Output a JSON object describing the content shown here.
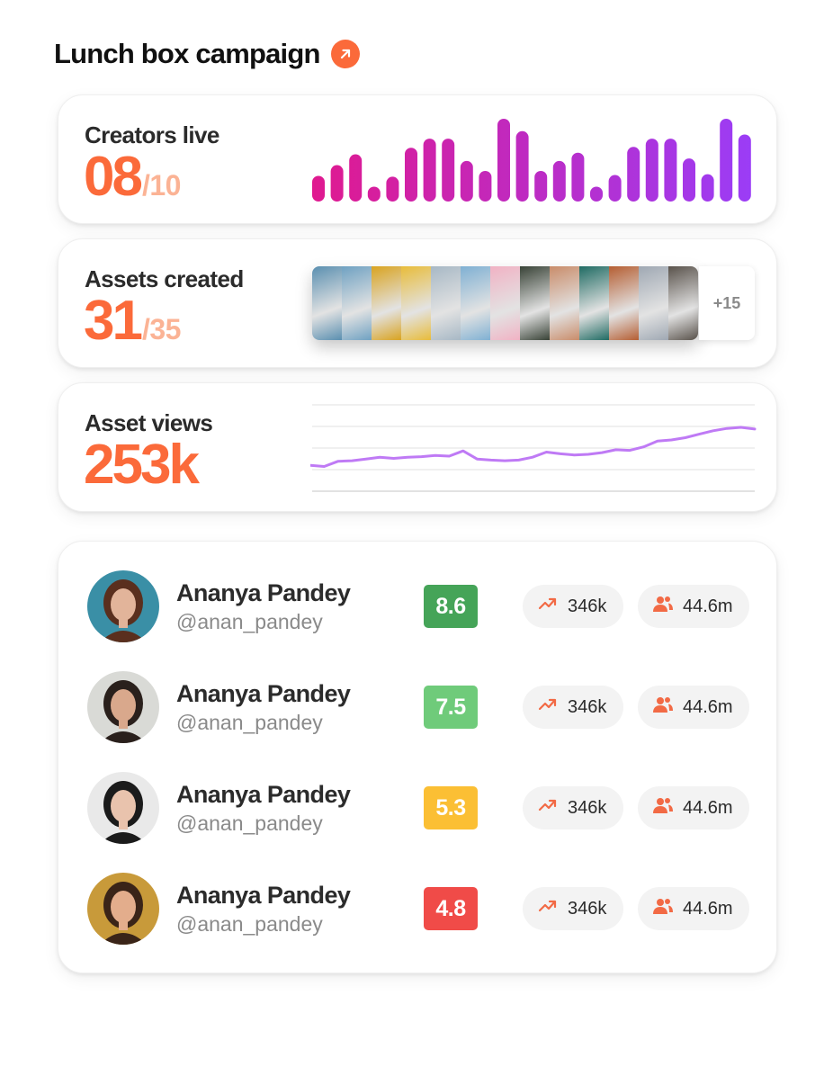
{
  "campaign": {
    "title": "Lunch box campaign",
    "link_icon": "arrow-up-right-icon",
    "accent": "#fb6a3a"
  },
  "creators_live": {
    "label": "Creators live",
    "value": "08",
    "total": "/10",
    "bars": [
      0.31,
      0.44,
      0.57,
      0.18,
      0.3,
      0.65,
      0.76,
      0.76,
      0.49,
      0.37,
      1.0,
      0.85,
      0.37,
      0.49,
      0.59,
      0.18,
      0.32,
      0.66,
      0.76,
      0.76,
      0.52,
      0.33,
      1.0,
      0.81
    ],
    "gradient": [
      "#e0198f",
      "#9b3df6"
    ]
  },
  "assets_created": {
    "label": "Assets created",
    "value": "31",
    "total": "/35",
    "more": "+15",
    "thumbnails": [
      "#5a8fb0",
      "#6fa1c2",
      "#d9a320",
      "#e8bc3a",
      "#a7b8c5",
      "#7fb0d3",
      "#f1b2c4",
      "#384236",
      "#c98c6a",
      "#1f6b63",
      "#b55e32",
      "#9fa8b3",
      "#59524b"
    ]
  },
  "asset_views": {
    "label": "Asset views",
    "value": "253k",
    "trend": [
      0.2,
      0.18,
      0.27,
      0.28,
      0.31,
      0.34,
      0.32,
      0.34,
      0.35,
      0.37,
      0.36,
      0.45,
      0.31,
      0.29,
      0.28,
      0.29,
      0.34,
      0.43,
      0.4,
      0.38,
      0.39,
      0.42,
      0.47,
      0.46,
      0.52,
      0.62,
      0.64,
      0.68,
      0.74,
      0.8,
      0.84,
      0.86,
      0.83
    ],
    "line_color": "#bf7af5"
  },
  "creators": [
    {
      "name": "Ananya Pandey",
      "handle": "@anan_pandey",
      "score": "8.6",
      "score_color": "#45a458",
      "views": "346k",
      "followers": "44.6m",
      "avatar_bg": "#3a8fa6",
      "avatar_skin": "#e2b49a",
      "avatar_hair": "#5a2f1e"
    },
    {
      "name": "Ananya Pandey",
      "handle": "@anan_pandey",
      "score": "7.5",
      "score_color": "#6fcb7a",
      "views": "346k",
      "followers": "44.6m",
      "avatar_bg": "#d9dad6",
      "avatar_skin": "#d9a88c",
      "avatar_hair": "#2a201c"
    },
    {
      "name": "Ananya Pandey",
      "handle": "@anan_pandey",
      "score": "5.3",
      "score_color": "#fbbf34",
      "views": "346k",
      "followers": "44.6m",
      "avatar_bg": "#e9e9e9",
      "avatar_skin": "#e9c3ad",
      "avatar_hair": "#1b1b1b"
    },
    {
      "name": "Ananya Pandey",
      "handle": "@anan_pandey",
      "score": "4.8",
      "score_color": "#f04b48",
      "views": "346k",
      "followers": "44.6m",
      "avatar_bg": "#c89a3a",
      "avatar_skin": "#e3ad8c",
      "avatar_hair": "#3a2418"
    }
  ],
  "icons": {
    "views": "trending-up-icon",
    "followers": "users-icon"
  }
}
